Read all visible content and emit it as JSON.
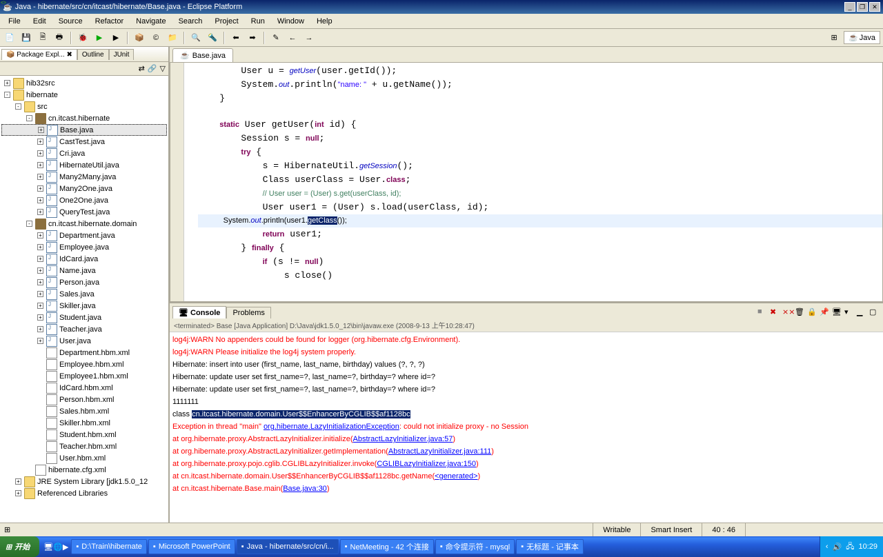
{
  "title": "Java - hibernate/src/cn/itcast/hibernate/Base.java - Eclipse Platform",
  "menu": [
    "File",
    "Edit",
    "Source",
    "Refactor",
    "Navigate",
    "Search",
    "Project",
    "Run",
    "Window",
    "Help"
  ],
  "perspective": "Java",
  "sidebar": {
    "tabs": [
      "Package Expl...",
      "Outline",
      "JUnit"
    ],
    "tree": [
      {
        "ind": 0,
        "exp": "+",
        "ico": "folder",
        "label": "hib32src"
      },
      {
        "ind": 0,
        "exp": "-",
        "ico": "folder",
        "label": "hibernate"
      },
      {
        "ind": 1,
        "exp": "-",
        "ico": "folder",
        "label": "src"
      },
      {
        "ind": 2,
        "exp": "-",
        "ico": "pkg",
        "label": "cn.itcast.hibernate"
      },
      {
        "ind": 3,
        "exp": "+",
        "ico": "java",
        "label": "Base.java",
        "sel": true
      },
      {
        "ind": 3,
        "exp": "+",
        "ico": "java",
        "label": "CastTest.java"
      },
      {
        "ind": 3,
        "exp": "+",
        "ico": "java",
        "label": "Cri.java"
      },
      {
        "ind": 3,
        "exp": "+",
        "ico": "java",
        "label": "HibernateUtil.java"
      },
      {
        "ind": 3,
        "exp": "+",
        "ico": "java",
        "label": "Many2Many.java"
      },
      {
        "ind": 3,
        "exp": "+",
        "ico": "java",
        "label": "Many2One.java"
      },
      {
        "ind": 3,
        "exp": "+",
        "ico": "java",
        "label": "One2One.java"
      },
      {
        "ind": 3,
        "exp": "+",
        "ico": "java",
        "label": "QueryTest.java"
      },
      {
        "ind": 2,
        "exp": "-",
        "ico": "pkg",
        "label": "cn.itcast.hibernate.domain"
      },
      {
        "ind": 3,
        "exp": "+",
        "ico": "java",
        "label": "Department.java"
      },
      {
        "ind": 3,
        "exp": "+",
        "ico": "java",
        "label": "Employee.java"
      },
      {
        "ind": 3,
        "exp": "+",
        "ico": "java",
        "label": "IdCard.java"
      },
      {
        "ind": 3,
        "exp": "+",
        "ico": "java",
        "label": "Name.java"
      },
      {
        "ind": 3,
        "exp": "+",
        "ico": "java",
        "label": "Person.java"
      },
      {
        "ind": 3,
        "exp": "+",
        "ico": "java",
        "label": "Sales.java"
      },
      {
        "ind": 3,
        "exp": "+",
        "ico": "java",
        "label": "Skiller.java"
      },
      {
        "ind": 3,
        "exp": "+",
        "ico": "java",
        "label": "Student.java"
      },
      {
        "ind": 3,
        "exp": "+",
        "ico": "java",
        "label": "Teacher.java"
      },
      {
        "ind": 3,
        "exp": "+",
        "ico": "java",
        "label": "User.java"
      },
      {
        "ind": 3,
        "exp": "",
        "ico": "xml",
        "label": "Department.hbm.xml"
      },
      {
        "ind": 3,
        "exp": "",
        "ico": "xml",
        "label": "Employee.hbm.xml"
      },
      {
        "ind": 3,
        "exp": "",
        "ico": "xml",
        "label": "Employee1.hbm.xml"
      },
      {
        "ind": 3,
        "exp": "",
        "ico": "xml",
        "label": "IdCard.hbm.xml"
      },
      {
        "ind": 3,
        "exp": "",
        "ico": "xml",
        "label": "Person.hbm.xml"
      },
      {
        "ind": 3,
        "exp": "",
        "ico": "xml",
        "label": "Sales.hbm.xml"
      },
      {
        "ind": 3,
        "exp": "",
        "ico": "xml",
        "label": "Skiller.hbm.xml"
      },
      {
        "ind": 3,
        "exp": "",
        "ico": "xml",
        "label": "Student.hbm.xml"
      },
      {
        "ind": 3,
        "exp": "",
        "ico": "xml",
        "label": "Teacher.hbm.xml"
      },
      {
        "ind": 3,
        "exp": "",
        "ico": "xml",
        "label": "User.hbm.xml"
      },
      {
        "ind": 2,
        "exp": "",
        "ico": "xml",
        "label": "hibernate.cfg.xml"
      },
      {
        "ind": 1,
        "exp": "+",
        "ico": "folder",
        "label": "JRE System Library [jdk1.5.0_12"
      },
      {
        "ind": 1,
        "exp": "+",
        "ico": "folder",
        "label": "Referenced Libraries"
      }
    ]
  },
  "editor": {
    "tab": "Base.java",
    "lines": [
      {
        "html": "        User u = <span class='it'>getUser</span>(user.getId());"
      },
      {
        "html": "        System.<span class='it'>out</span>.println(<span class='st'>\"name: \"</span> + u.getName());"
      },
      {
        "html": "    }"
      },
      {
        "html": ""
      },
      {
        "html": "    <span class='kw'>static</span> User getUser(<span class='kw'>int</span> id) {"
      },
      {
        "html": "        Session s = <span class='kw'>null</span>;"
      },
      {
        "html": "        <span class='kw'>try</span> {"
      },
      {
        "html": "            s = HibernateUtil.<span class='it'>getSession</span>();"
      },
      {
        "html": "            Class userClass = User.<span class='kw'>class</span>;"
      },
      {
        "html": "            <span class='cm'>// User user = (User) s.get(userClass, id);</span>"
      },
      {
        "html": "            User user1 = (User) s.load(userClass, id);"
      },
      {
        "html": "<span class='hl-line'>            System.<span class='it'>out</span>.println(user1.<span class='sel'>getClass</span>());</span>"
      },
      {
        "html": "            <span class='kw'>return</span> user1;"
      },
      {
        "html": "        } <span class='kw'>finally</span> {"
      },
      {
        "html": "            <span class='kw'>if</span> (s != <span class='kw'>null</span>)"
      },
      {
        "html": "                s close()"
      }
    ]
  },
  "bottom": {
    "tabs": [
      "Console",
      "Problems"
    ],
    "header": "<terminated> Base [Java Application] D:\\Java\\jdk1.5.0_12\\bin\\javaw.exe (2008-9-13 上午10:28:47)",
    "lines": [
      {
        "cls": "err",
        "text": "log4j:WARN No appenders could be found for logger (org.hibernate.cfg.Environment)."
      },
      {
        "cls": "err",
        "text": "log4j:WARN Please initialize the log4j system properly."
      },
      {
        "cls": "",
        "text": "Hibernate: insert into user (first_name, last_name, birthday) values (?, ?, ?)"
      },
      {
        "cls": "",
        "text": "Hibernate: update user set first_name=?, last_name=?, birthday=? where id=?"
      },
      {
        "cls": "",
        "text": "Hibernate: update user set first_name=?, last_name=?, birthday=? where id=?"
      },
      {
        "cls": "",
        "text": "1111111"
      },
      {
        "cls": "",
        "html": "class <span class='consel'>cn.itcast.hibernate.domain.User$$EnhancerByCGLIB$$af1128bc</span>"
      },
      {
        "cls": "err",
        "html": "Exception in thread \"main\" <span class='link'>org.hibernate.LazyInitializationException</span>: could not initialize proxy - no Session"
      },
      {
        "cls": "err",
        "html": "    at org.hibernate.proxy.AbstractLazyInitializer.initialize(<span class='link'>AbstractLazyInitializer.java:57</span>)"
      },
      {
        "cls": "err",
        "html": "    at org.hibernate.proxy.AbstractLazyInitializer.getImplementation(<span class='link'>AbstractLazyInitializer.java:111</span>)"
      },
      {
        "cls": "err",
        "html": "    at org.hibernate.proxy.pojo.cglib.CGLIBLazyInitializer.invoke(<span class='link'>CGLIBLazyInitializer.java:150</span>)"
      },
      {
        "cls": "err",
        "html": "    at cn.itcast.hibernate.domain.User$$EnhancerByCGLIB$$af1128bc.getName(<span class='link'>&lt;generated&gt;</span>)"
      },
      {
        "cls": "err",
        "html": "    at cn.itcast.hibernate.Base.main(<span class='link'>Base.java:30</span>)"
      }
    ]
  },
  "status": {
    "writable": "Writable",
    "insert": "Smart Insert",
    "pos": "40 : 46"
  },
  "taskbar": {
    "start": "开始",
    "items": [
      "D:\\Train\\hibernate",
      "Microsoft PowerPoint",
      "Java - hibernate/src/cn/i...",
      "NetMeeting - 42 个连接",
      "命令提示符 - mysql",
      "无标题 - 记事本"
    ],
    "time": "10:29"
  }
}
